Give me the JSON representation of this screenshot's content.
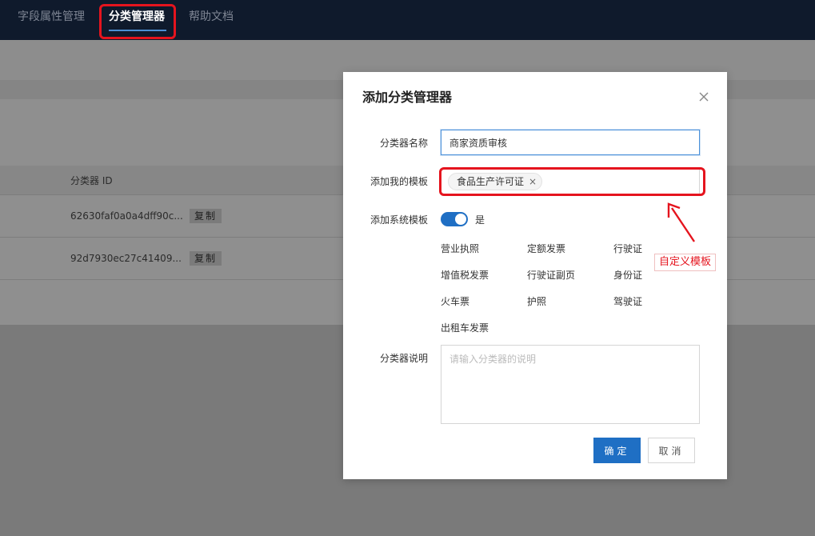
{
  "nav": {
    "items": [
      {
        "label": "字段属性管理"
      },
      {
        "label": "分类管理器"
      },
      {
        "label": "帮助文档"
      }
    ]
  },
  "background": {
    "column_header": "分类器 ID",
    "rows": [
      {
        "id": "62630faf0a0a4dff90c...",
        "copy_label": "复制"
      },
      {
        "id": "92d7930ec27c41409...",
        "copy_label": "复制"
      }
    ]
  },
  "modal": {
    "title": "添加分类管理器",
    "close_icon": "close-icon",
    "name": {
      "label": "分类器名称",
      "value": "商家资质审核"
    },
    "my_template": {
      "label": "添加我的模板",
      "tags": [
        {
          "label": "食品生产许可证"
        }
      ]
    },
    "system_template": {
      "label": "添加系统模板",
      "toggle_on": true,
      "toggle_label": "是",
      "items": [
        "营业执照",
        "定额发票",
        "行驶证",
        "增值税发票",
        "行驶证副页",
        "身份证",
        "火车票",
        "护照",
        "驾驶证",
        "出租车发票"
      ]
    },
    "description": {
      "label": "分类器说明",
      "placeholder": "请输入分类器的说明",
      "value": ""
    },
    "confirm_label": "确定",
    "cancel_label": "取消"
  },
  "annotation": {
    "label": "自定义模板",
    "color": "#e5141e"
  },
  "colors": {
    "primary": "#1f6fc4",
    "nav_bg": "#0f1a2c",
    "highlight": "#e5141e"
  }
}
